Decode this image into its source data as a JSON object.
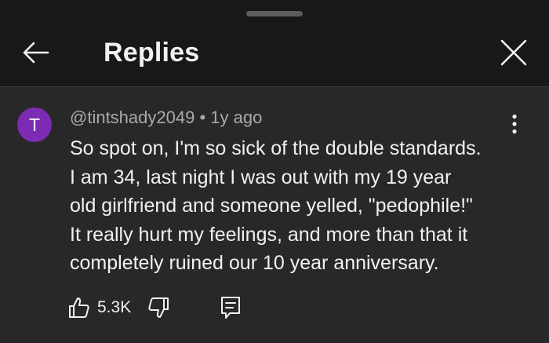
{
  "header": {
    "title": "Replies",
    "back_icon": "arrow-back-icon",
    "close_icon": "close-icon"
  },
  "comment": {
    "avatar_letter": "T",
    "avatar_color": "#7b2cb2",
    "author": "@tintshady2049",
    "separator": "•",
    "time": "1y ago",
    "lines": [
      "So spot on, I'm so sick of the double standards.",
      "I am 34, last night I was out with my 19 year",
      "old girlfriend and someone yelled, \"pedophile!\"",
      "It really hurt my feelings, and more than that it",
      "completely ruined our 10 year anniversary."
    ],
    "like_count": "5.3K"
  }
}
